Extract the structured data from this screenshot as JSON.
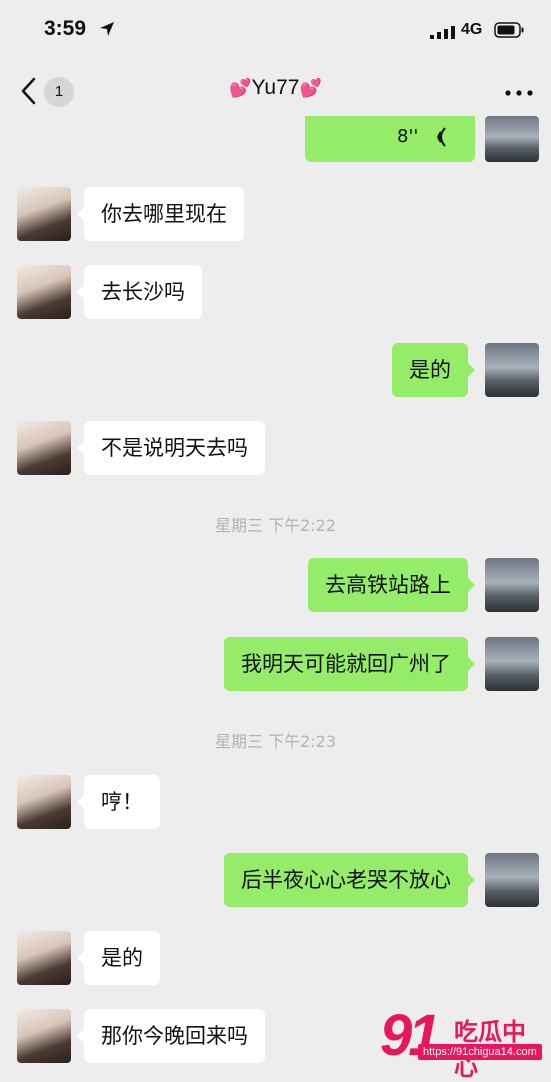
{
  "status_bar": {
    "time": "3:59",
    "network": "4G"
  },
  "nav": {
    "back_count": "1",
    "title": "Yu77",
    "title_heart": "💕"
  },
  "voice_message": {
    "duration": "8''"
  },
  "messages": [
    {
      "side": "in",
      "text": "你去哪里现在"
    },
    {
      "side": "in",
      "text": "去长沙吗"
    },
    {
      "side": "out",
      "text": "是的"
    },
    {
      "side": "in",
      "text": "不是说明天去吗"
    },
    {
      "side": "out",
      "text": "去高铁站路上"
    },
    {
      "side": "out",
      "text": "我明天可能就回广州了"
    },
    {
      "side": "in",
      "text": "哼！"
    },
    {
      "side": "out",
      "text": "后半夜心心老哭不放心"
    },
    {
      "side": "in",
      "text": "是的"
    },
    {
      "side": "in",
      "text": "那你今晚回来吗"
    }
  ],
  "timestamps": [
    "星期三 下午2:22",
    "星期三 下午2:23"
  ],
  "watermark": {
    "number": "91",
    "name": "吃瓜中心",
    "url": "https://91chigua14.com"
  },
  "colors": {
    "background": "#ededed",
    "outgoing_bubble": "#95ec69",
    "incoming_bubble": "#ffffff",
    "timestamp": "#b2b2b2",
    "watermark": "#e8175d"
  }
}
